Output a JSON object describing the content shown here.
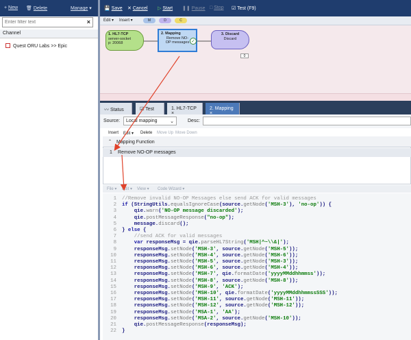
{
  "left_panel": {
    "toolbar": {
      "new": "New",
      "delete": "Delete",
      "manage": "Manage"
    },
    "filter_placeholder": "Enter filter text",
    "channel_header": "Channel",
    "channels": [
      "Quest ORU Labs >> Epic"
    ]
  },
  "main_toolbar": {
    "save": "Save",
    "cancel": "Cancel",
    "start": "Start",
    "pause": "Pause",
    "stop": "Stop",
    "test": "Test (F9)"
  },
  "sub_toolbar": {
    "edit": "Edit",
    "insert": "Insert",
    "badges": [
      "M",
      "D",
      "C"
    ]
  },
  "nodes": [
    {
      "id": "1. HL7-TCP",
      "lines": [
        "server-socket",
        "p: 20068"
      ]
    },
    {
      "id": "2. Mapping",
      "lines": [
        "Remove NO-",
        "OP messages"
      ]
    },
    {
      "id": "3. Discard",
      "lines": [
        "Discard"
      ],
      "count": "0"
    }
  ],
  "tabs": [
    "Status",
    "Test",
    "1. HL7-TCP",
    "2. Mapping"
  ],
  "source_row": {
    "label": "Source:",
    "value": "Local mapping",
    "desc_label": "Desc:"
  },
  "edit_row": {
    "insert": "Insert",
    "edit": "Edit",
    "delete": "Delete",
    "move_up": "Move Up",
    "move_down": "Move Down"
  },
  "function_table": {
    "header": "Mapping Function",
    "rows": [
      {
        "n": "1",
        "text": "Remove NO-OP messages"
      }
    ]
  },
  "code_toolbar": {
    "file": "File",
    "edit": "Edit",
    "view": "View",
    "wizard": "Code Wizard"
  },
  "code_lines": [
    "//Remove invalid NO-OP Messages else send ACK for valid messages",
    "if (StringUtils.equalsIgnoreCase(source.getNode('MSH-3'), 'no-op')) {",
    "    qie.warn('NO-OP message discarded');",
    "    qie.postMessageResponse(\"no-op\");",
    "    message.discard();",
    "} else {",
    "    //send ACK for valid messages",
    "    var responseMsg = qie.parseHL7String('MSH|^~\\\\&|');",
    "    responseMsg.setNode('MSH-3', source.getNode('MSH-5'));",
    "    responseMsg.setNode('MSH-4', source.getNode('MSH-6'));",
    "    responseMsg.setNode('MSH-5', source.getNode('MSH-3'));",
    "    responseMsg.setNode('MSH-6', source.getNode('MSH-4'));",
    "    responseMsg.setNode('MSH-7', qie.formatDate('yyyyMMddhhmmss'));",
    "    responseMsg.setNode('MSH-8', source.getNode('MSH-8'));",
    "    responseMsg.setNode('MSH-9', 'ACK');",
    "    responseMsg.setNode('MSH-10', qie.formatDate('yyyyMMddhhmmssSSS'));",
    "    responseMsg.setNode('MSH-11', source.getNode('MSH-11'));",
    "    responseMsg.setNode('MSH-12', source.getNode('MSH-12'));",
    "    responseMsg.setNode('MSA-1', 'AA');",
    "    responseMsg.setNode('MSA-2', source.getNode('MSH-10'));",
    "    qie.postMessageResponse(responseMsg);",
    "}"
  ],
  "colors": {
    "toolbar": "#1f3d6e",
    "accent": "#e0422a",
    "node1": "#b4e08a",
    "node2": "#bfd8f3",
    "node3": "#c6c0f1"
  }
}
